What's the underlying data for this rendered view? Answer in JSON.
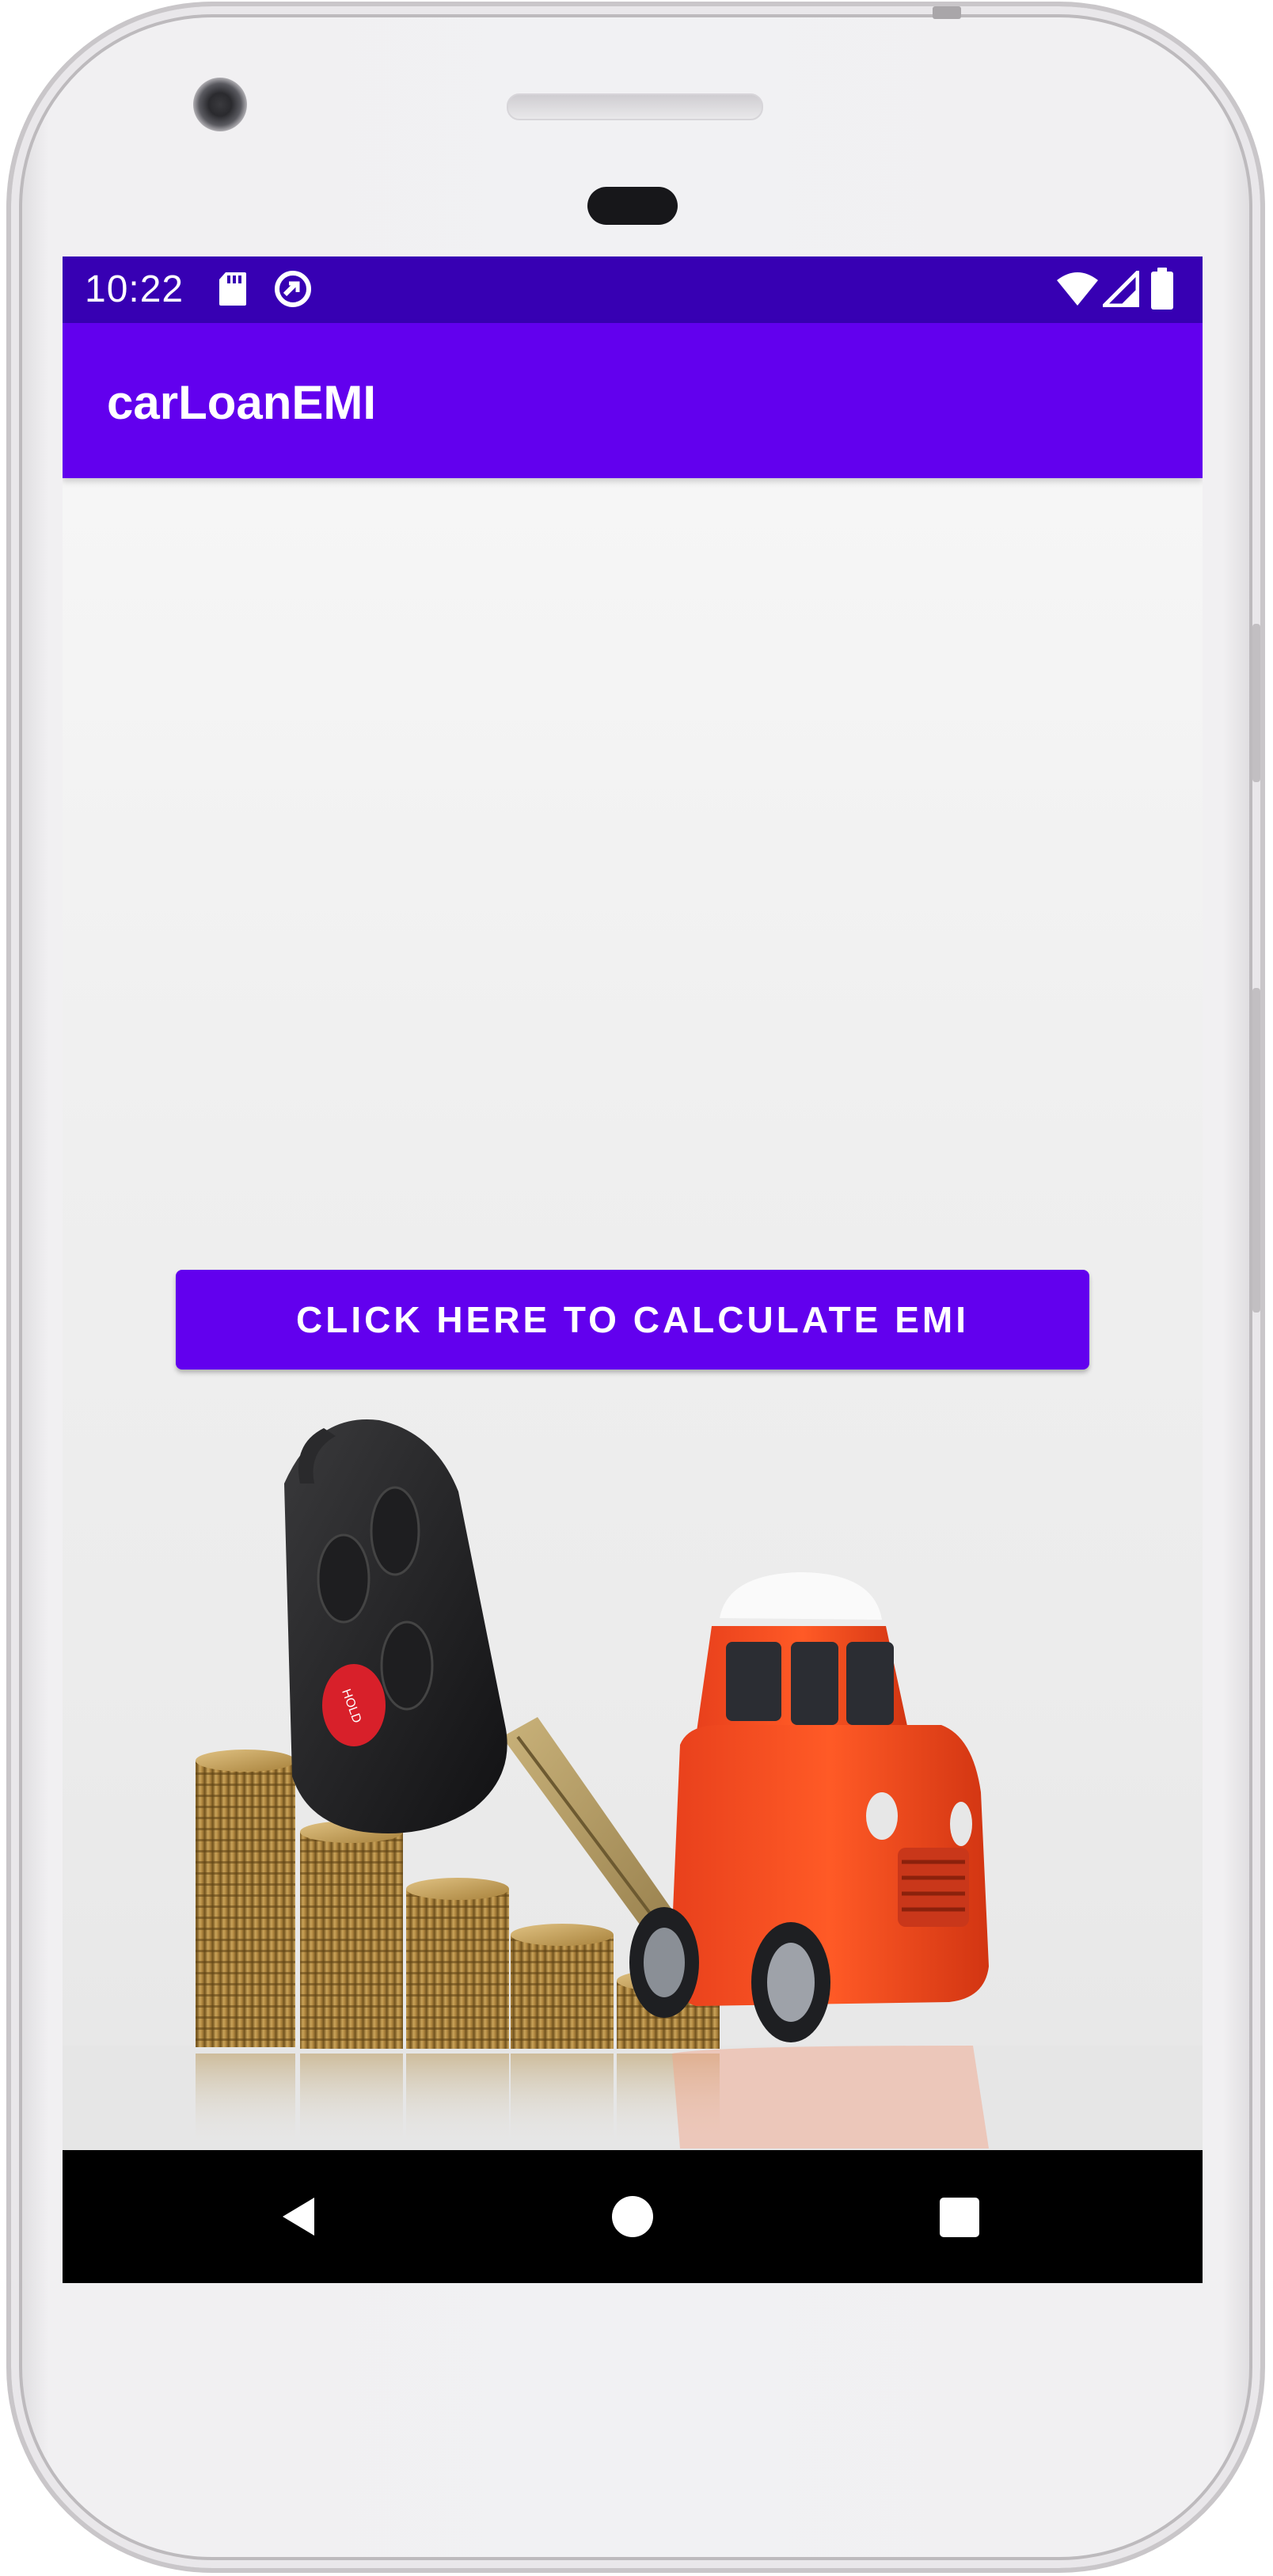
{
  "status_bar": {
    "time": "10:22",
    "icons": [
      "sd-card-icon",
      "sync-icon",
      "wifi-icon",
      "signal-icon",
      "battery-icon"
    ],
    "background": "#3700b3"
  },
  "app_bar": {
    "title": "carLoanEMI",
    "background": "#6200ee"
  },
  "main": {
    "calculate_button_label": "CLICK HERE TO CALCULATE EMI",
    "image": "car-key-coins-toy-car-image"
  },
  "nav_bar": {
    "buttons": [
      "back-icon",
      "home-icon",
      "recents-icon"
    ]
  },
  "colors": {
    "accent": "#6200ee",
    "status": "#3700b3"
  }
}
